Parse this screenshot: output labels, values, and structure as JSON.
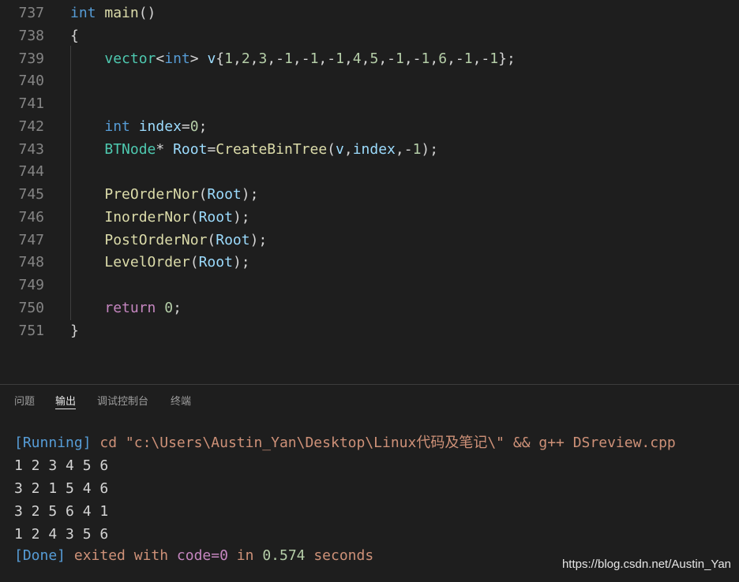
{
  "editor": {
    "lines": [
      {
        "num": "737",
        "tokens": [
          [
            "kw",
            "int"
          ],
          [
            "pun",
            " "
          ],
          [
            "fn",
            "main"
          ],
          [
            "pun",
            "()"
          ]
        ]
      },
      {
        "num": "738",
        "tokens": [
          [
            "pun",
            "{"
          ]
        ]
      },
      {
        "num": "739",
        "tokens": [
          [
            "pun",
            "    "
          ],
          [
            "ty",
            "vector"
          ],
          [
            "pun",
            "<"
          ],
          [
            "kw",
            "int"
          ],
          [
            "pun",
            "> "
          ],
          [
            "var",
            "v"
          ],
          [
            "pun",
            "{"
          ],
          [
            "num",
            "1"
          ],
          [
            "pun",
            ","
          ],
          [
            "num",
            "2"
          ],
          [
            "pun",
            ","
          ],
          [
            "num",
            "3"
          ],
          [
            "pun",
            ",-"
          ],
          [
            "num",
            "1"
          ],
          [
            "pun",
            ",-"
          ],
          [
            "num",
            "1"
          ],
          [
            "pun",
            ",-"
          ],
          [
            "num",
            "1"
          ],
          [
            "pun",
            ","
          ],
          [
            "num",
            "4"
          ],
          [
            "pun",
            ","
          ],
          [
            "num",
            "5"
          ],
          [
            "pun",
            ",-"
          ],
          [
            "num",
            "1"
          ],
          [
            "pun",
            ",-"
          ],
          [
            "num",
            "1"
          ],
          [
            "pun",
            ","
          ],
          [
            "num",
            "6"
          ],
          [
            "pun",
            ",-"
          ],
          [
            "num",
            "1"
          ],
          [
            "pun",
            ",-"
          ],
          [
            "num",
            "1"
          ],
          [
            "pun",
            "};"
          ]
        ]
      },
      {
        "num": "740",
        "tokens": []
      },
      {
        "num": "741",
        "tokens": []
      },
      {
        "num": "742",
        "tokens": [
          [
            "pun",
            "    "
          ],
          [
            "kw",
            "int"
          ],
          [
            "pun",
            " "
          ],
          [
            "var",
            "index"
          ],
          [
            "pun",
            "="
          ],
          [
            "num",
            "0"
          ],
          [
            "pun",
            ";"
          ]
        ]
      },
      {
        "num": "743",
        "tokens": [
          [
            "pun",
            "    "
          ],
          [
            "ty",
            "BTNode"
          ],
          [
            "pun",
            "* "
          ],
          [
            "var",
            "Root"
          ],
          [
            "pun",
            "="
          ],
          [
            "fn",
            "CreateBinTree"
          ],
          [
            "pun",
            "("
          ],
          [
            "var",
            "v"
          ],
          [
            "pun",
            ","
          ],
          [
            "var",
            "index"
          ],
          [
            "pun",
            ",-"
          ],
          [
            "num",
            "1"
          ],
          [
            "pun",
            ");"
          ]
        ]
      },
      {
        "num": "744",
        "tokens": []
      },
      {
        "num": "745",
        "tokens": [
          [
            "pun",
            "    "
          ],
          [
            "fn",
            "PreOrderNor"
          ],
          [
            "pun",
            "("
          ],
          [
            "var",
            "Root"
          ],
          [
            "pun",
            ");"
          ]
        ]
      },
      {
        "num": "746",
        "tokens": [
          [
            "pun",
            "    "
          ],
          [
            "fn",
            "InorderNor"
          ],
          [
            "pun",
            "("
          ],
          [
            "var",
            "Root"
          ],
          [
            "pun",
            ");"
          ]
        ]
      },
      {
        "num": "747",
        "tokens": [
          [
            "pun",
            "    "
          ],
          [
            "fn",
            "PostOrderNor"
          ],
          [
            "pun",
            "("
          ],
          [
            "var",
            "Root"
          ],
          [
            "pun",
            ");"
          ]
        ]
      },
      {
        "num": "748",
        "tokens": [
          [
            "pun",
            "    "
          ],
          [
            "fn",
            "LevelOrder"
          ],
          [
            "pun",
            "("
          ],
          [
            "var",
            "Root"
          ],
          [
            "pun",
            ");"
          ]
        ]
      },
      {
        "num": "749",
        "tokens": []
      },
      {
        "num": "750",
        "tokens": [
          [
            "pun",
            "    "
          ],
          [
            "ctl",
            "return"
          ],
          [
            "pun",
            " "
          ],
          [
            "num",
            "0"
          ],
          [
            "pun",
            ";"
          ]
        ]
      },
      {
        "num": "751",
        "tokens": [
          [
            "pun",
            "}"
          ]
        ]
      }
    ]
  },
  "panel": {
    "tabs": [
      {
        "label": "问题",
        "active": false
      },
      {
        "label": "输出",
        "active": true
      },
      {
        "label": "调试控制台",
        "active": false
      },
      {
        "label": "终端",
        "active": false
      }
    ]
  },
  "output": {
    "running_tag": "[Running]",
    "command": " cd \"c:\\Users\\Austin_Yan\\Desktop\\Linux代码及笔记\\\" && g++ DSreview.cpp",
    "results": [
      "1 2 3 4 5 6",
      "3 2 1 5 4 6",
      "3 2 5 6 4 1",
      "1 2 4 3 5 6"
    ],
    "done_tag": "[Done]",
    "exited_with": " exited with ",
    "code_text": "code=0",
    "in_text": " in ",
    "seconds_value": "0.574",
    "seconds_text": " seconds"
  },
  "watermark": "https://blog.csdn.net/Austin_Yan",
  "colors": {
    "background": "#1e1e1e",
    "keyword": "#569cd6",
    "function": "#dcdcaa",
    "type": "#4ec9b0",
    "variable": "#9cdcfe",
    "number": "#b5cea8",
    "control": "#c586c0",
    "string": "#ce9178"
  }
}
